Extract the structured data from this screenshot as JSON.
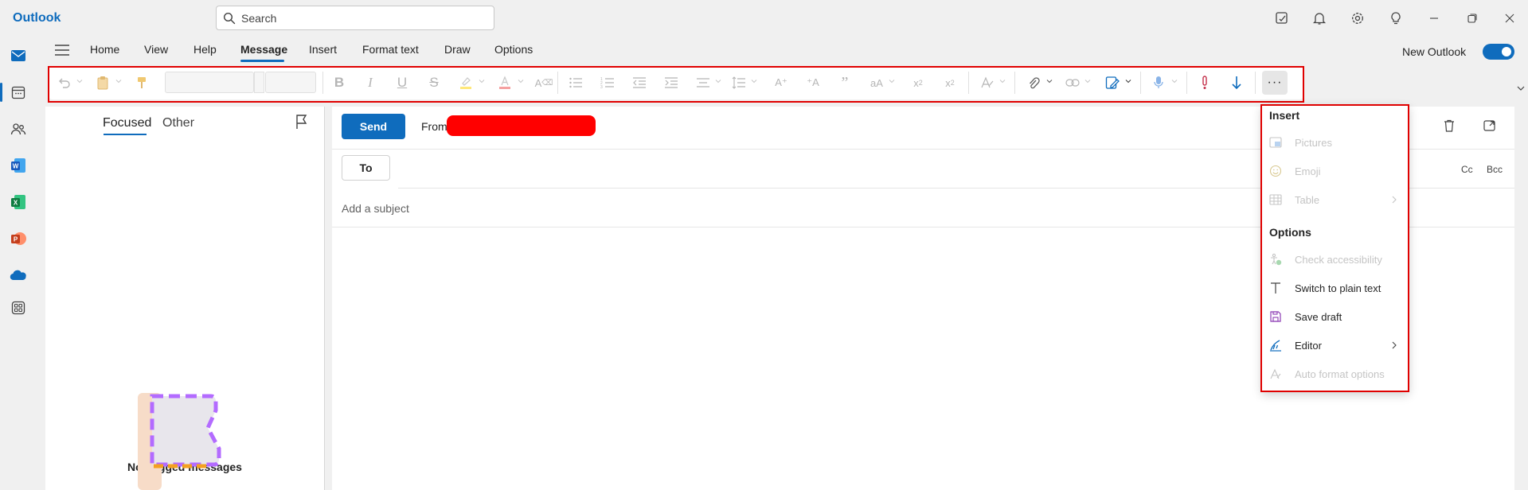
{
  "app": {
    "title": "Outlook"
  },
  "search": {
    "placeholder": "Search"
  },
  "titlebar_icons": [
    "notes-icon",
    "bell-icon",
    "gear-icon",
    "lightbulb-icon",
    "minimize-icon",
    "restore-icon",
    "close-icon"
  ],
  "rail": [
    "mail-icon",
    "calendar-icon",
    "people-icon",
    "word-icon",
    "excel-icon",
    "powerpoint-icon",
    "onedrive-icon",
    "apps-icon"
  ],
  "ribbon": {
    "tabs": [
      "Home",
      "View",
      "Help",
      "Message",
      "Insert",
      "Format text",
      "Draw",
      "Options"
    ],
    "active_tab": "Message",
    "new_outlook_label": "New Outlook",
    "new_outlook_on": true
  },
  "toolbar": {
    "font_name": "",
    "font_size": "",
    "more_label": "···"
  },
  "folder_pane": {
    "tabs": [
      "Focused",
      "Other"
    ],
    "active_tab": "Focused",
    "empty_message": "No flagged messages"
  },
  "compose": {
    "send_label": "Send",
    "from_label": "From",
    "to_label": "To",
    "cc_label": "Cc",
    "bcc_label": "Bcc",
    "subject_placeholder": "Add a subject"
  },
  "overflow_menu": {
    "insert_heading": "Insert",
    "insert_items": [
      {
        "label": "Pictures",
        "icon": "picture-icon",
        "disabled": true
      },
      {
        "label": "Emoji",
        "icon": "emoji-icon",
        "disabled": true
      },
      {
        "label": "Table",
        "icon": "table-icon",
        "disabled": true,
        "submenu": true
      }
    ],
    "options_heading": "Options",
    "options_items": [
      {
        "label": "Check accessibility",
        "icon": "accessibility-icon",
        "disabled": true
      },
      {
        "label": "Switch to plain text",
        "icon": "plain-text-icon",
        "disabled": false
      },
      {
        "label": "Save draft",
        "icon": "save-icon",
        "disabled": false
      },
      {
        "label": "Editor",
        "icon": "editor-icon",
        "disabled": false,
        "submenu": true
      },
      {
        "label": "Auto format options",
        "icon": "auto-format-icon",
        "disabled": true
      }
    ]
  },
  "colors": {
    "accent": "#0f6cbd",
    "highlight_box": "#e00000",
    "redaction": "#ff0000"
  }
}
